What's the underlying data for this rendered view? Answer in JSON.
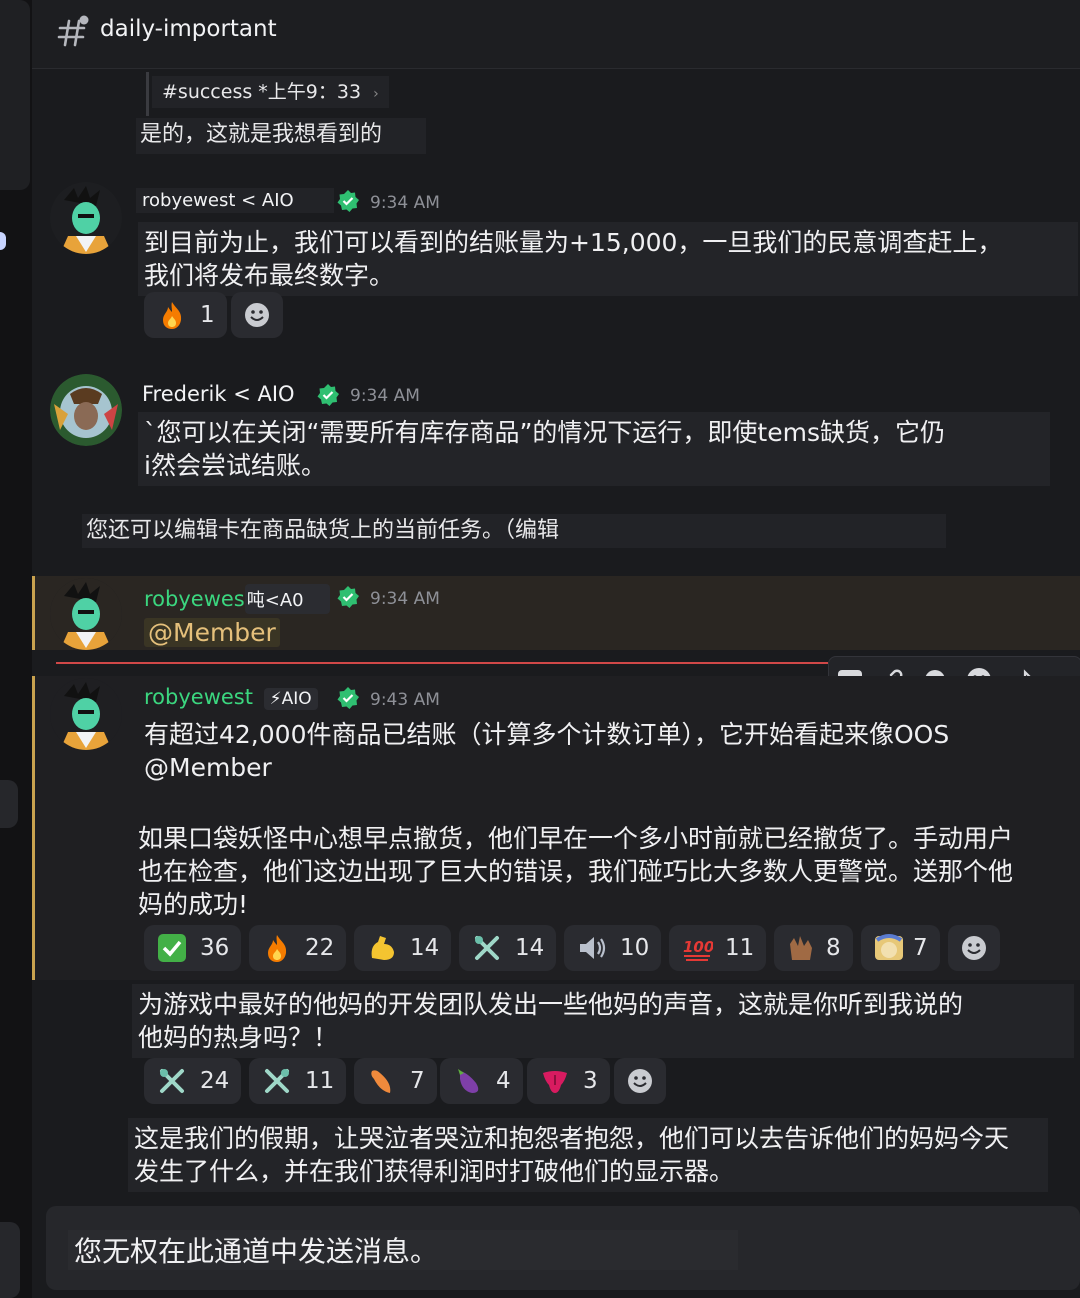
{
  "channel": {
    "name": "daily-important",
    "icon": "hash-thread-icon"
  },
  "reply_preview": {
    "text": "#success *上午9：33",
    "chevron": "›"
  },
  "messages": [
    {
      "id": "m0",
      "text": "是的，这就是我想看到的"
    },
    {
      "id": "m1",
      "author": "robyewest < AIO",
      "time": "9:34 AM",
      "lines": [
        "到目前为止，我们可以看到的结账量为+15,000，一旦我们的民意调查赶上，",
        "我们将发布最终数字。"
      ],
      "reactions": [
        {
          "emoji": "fire",
          "count": "1"
        }
      ]
    },
    {
      "id": "m2",
      "author": "Frederik < AIO",
      "time": "9:34 AM",
      "lines": [
        "`您可以在关闭“需要所有库存商品”的情况下运行，即使tems缺货，它仍",
        "i然会尝试结账。"
      ]
    },
    {
      "id": "m3",
      "text": "您还可以编辑卡在商品缺货上的当前任务。（编辑"
    },
    {
      "id": "m4",
      "author": "robyewes",
      "author_tail": "吨<A0",
      "time": "9:34 AM",
      "mention": "@Member"
    },
    {
      "id": "m5",
      "author": "robyewest",
      "badge": "⚡AIO",
      "time": "9:43 AM",
      "lines": [
        "有超过42,000件商品已结账（计算多个计数订单），它开始看起来像OOS",
        "@Member"
      ],
      "para2": [
        "如果口袋妖怪中心想早点撤货，他们早在一个多小时前就已经撤货了。手动用户",
        "也在检查，他们这边出现了巨大的错误，我们碰巧比大多数人更警觉。送那个他",
        "妈的成功!"
      ],
      "reactions": [
        {
          "emoji": "check",
          "count": "36"
        },
        {
          "emoji": "fire",
          "count": "22"
        },
        {
          "emoji": "muscle",
          "count": "14"
        },
        {
          "emoji": "tools",
          "count": "14"
        },
        {
          "emoji": "speaker",
          "count": "10"
        },
        {
          "emoji": "hundred",
          "count": "11"
        },
        {
          "emoji": "hands",
          "count": "8"
        },
        {
          "emoji": "sticker",
          "count": "7"
        }
      ]
    },
    {
      "id": "m6",
      "lines": [
        "为游戏中最好的他妈的开发团队发出一些他妈的声音，这就是你听到我说的",
        "他妈的热身吗？！"
      ],
      "reactions": [
        {
          "emoji": "tools",
          "count": "24"
        },
        {
          "emoji": "tools2",
          "count": "11"
        },
        {
          "emoji": "pepper",
          "count": "7"
        },
        {
          "emoji": "eggplant",
          "count": "4"
        },
        {
          "emoji": "tongue",
          "count": "3"
        }
      ]
    },
    {
      "id": "m7",
      "lines": [
        "这是我们的假期，让哭泣者哭泣和抱怨者抱怨，他们可以去告诉他们的妈妈今天",
        "发生了什么，并在我们获得利润时打破他们的显示器。"
      ]
    }
  ],
  "toolbar": {
    "id_label": "ID"
  },
  "composer": {
    "text": "您无权在此通道中发送消息。"
  },
  "colors": {
    "accent_green": "#3bd67f",
    "highlight_border": "#c9a24f",
    "divider": "#d04848"
  }
}
